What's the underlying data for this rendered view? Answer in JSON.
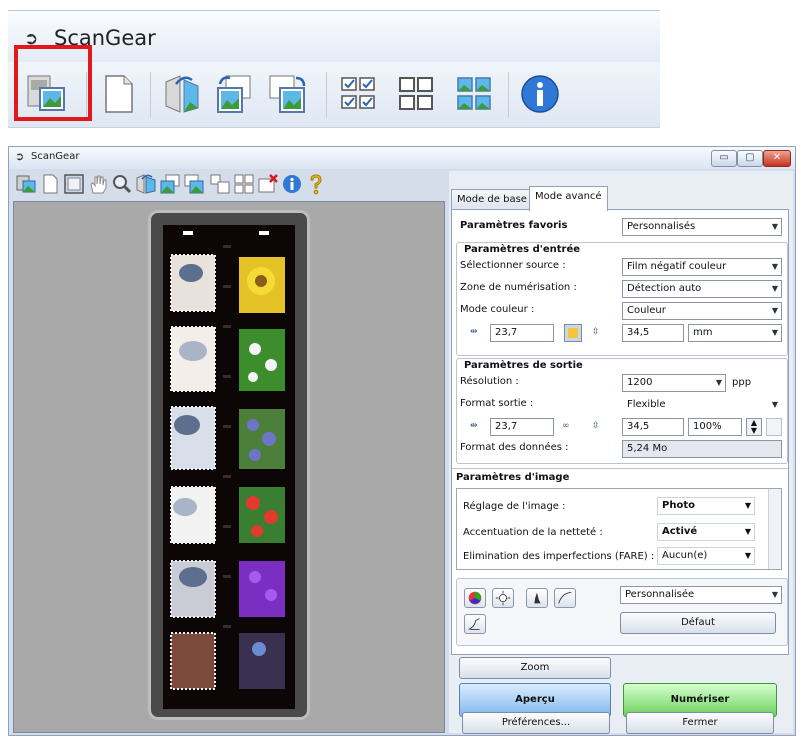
{
  "top": {
    "app_title": "ScanGear",
    "toolbar_icons": [
      "film-scan-icon",
      "blank-page-icon",
      "rotate-left-icon",
      "rotate-right-icon",
      "flip-icon",
      "thumbnail-view-icon",
      "whole-image-view-icon",
      "invert-selection-icon",
      "info-icon"
    ]
  },
  "window": {
    "title": "ScanGear",
    "buttons": {
      "minimize": "▭",
      "maximize": "▢",
      "close": "✕"
    }
  },
  "panel": {
    "tabs": {
      "basic": "Mode de base",
      "advanced": "Mode avancé"
    },
    "favorites": {
      "label": "Paramètres favoris",
      "value": "Personnalisés"
    },
    "input": {
      "header": "Paramètres d'entrée",
      "source_label": "Sélectionner source :",
      "source_value": "Film négatif couleur",
      "zone_label": "Zone de numérisation :",
      "zone_value": "Détection auto",
      "color_label": "Mode couleur :",
      "color_value": "Couleur",
      "width": "23,7",
      "height": "34,5",
      "unit": "mm"
    },
    "output": {
      "header": "Paramètres de sortie",
      "resolution_label": "Résolution :",
      "resolution_value": "1200",
      "resolution_unit": "ppp",
      "size_label": "Format sortie :",
      "size_value": "Flexible",
      "width": "23,7",
      "height": "34,5",
      "scale": "100%",
      "data_label": "Format des données :",
      "data_value": "5,24 Mo"
    },
    "image": {
      "header": "Paramètres d'image",
      "rows": [
        {
          "label": "Réglage de l'image :",
          "value": "Photo"
        },
        {
          "label": "Accentuation de la netteté :",
          "value": "Activé"
        },
        {
          "label": "Elimination des imperfections (FARE) :",
          "value": "Aucun(e)"
        }
      ]
    },
    "tone": {
      "preset": "Personnalisée",
      "default_button": "Défaut"
    },
    "zoom_button": "Zoom",
    "preview_button": "Aperçu",
    "scan_button": "Numériser",
    "preferences_button": "Préférences...",
    "close_button": "Fermer"
  },
  "colors": {
    "highlight": "#e3181c",
    "preview_button": "#82b7ec",
    "scan_button": "#6bd25d"
  }
}
